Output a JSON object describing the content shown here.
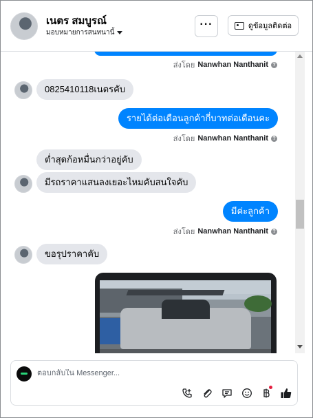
{
  "header": {
    "name": "เนตร สมบูรณ์",
    "assign_label": "มอบหมายการสนทนานี้",
    "more_label": "···",
    "contact_button": "ดูข้อมูลติดต่อ"
  },
  "messages": [
    {
      "sender": "page",
      "sent_by_prefix": "ส่งโดย",
      "sent_by_name": "Nanwhan Nanthanit"
    },
    {
      "sender": "customer",
      "text": "0825410118เนตรคับ"
    },
    {
      "sender": "page",
      "text": "รายได้ต่อเดือนลูกค้ากี่บาทต่อเดือนคะ",
      "sent_by_prefix": "ส่งโดย",
      "sent_by_name": "Nanwhan Nanthanit"
    },
    {
      "sender": "customer",
      "text": "ต่ำสุดก้อหมื่นกว่าอยู่คับ"
    },
    {
      "sender": "customer",
      "text": "มีรถราคาแสนลงเยอะไหมคับสนใจคับ"
    },
    {
      "sender": "page",
      "text": "มีค่ะลูกค้า",
      "sent_by_prefix": "ส่งโดย",
      "sent_by_name": "Nanwhan Nanthanit"
    },
    {
      "sender": "customer",
      "text": "ขอรุปราคาคับ"
    },
    {
      "sender": "customer",
      "attachment": "photo",
      "photo_subject": "pickup-truck"
    }
  ],
  "composer": {
    "placeholder": "ตอบกลับใน Messenger..."
  },
  "icons": {
    "more": "ellipsis-icon",
    "contact": "contact-card-icon",
    "help": "help-circle-icon",
    "call": "phone-plus-icon",
    "attach": "paperclip-icon",
    "saved_reply": "chat-bubble-icon",
    "emoji": "smiley-icon",
    "payment": "baht-icon",
    "like": "thumbs-up-icon"
  },
  "colors": {
    "outgoing_bubble": "#0084ff",
    "incoming_bubble": "#e4e6eb",
    "notification_dot": "#e41e3f",
    "like_icon": "#1c1e21"
  }
}
